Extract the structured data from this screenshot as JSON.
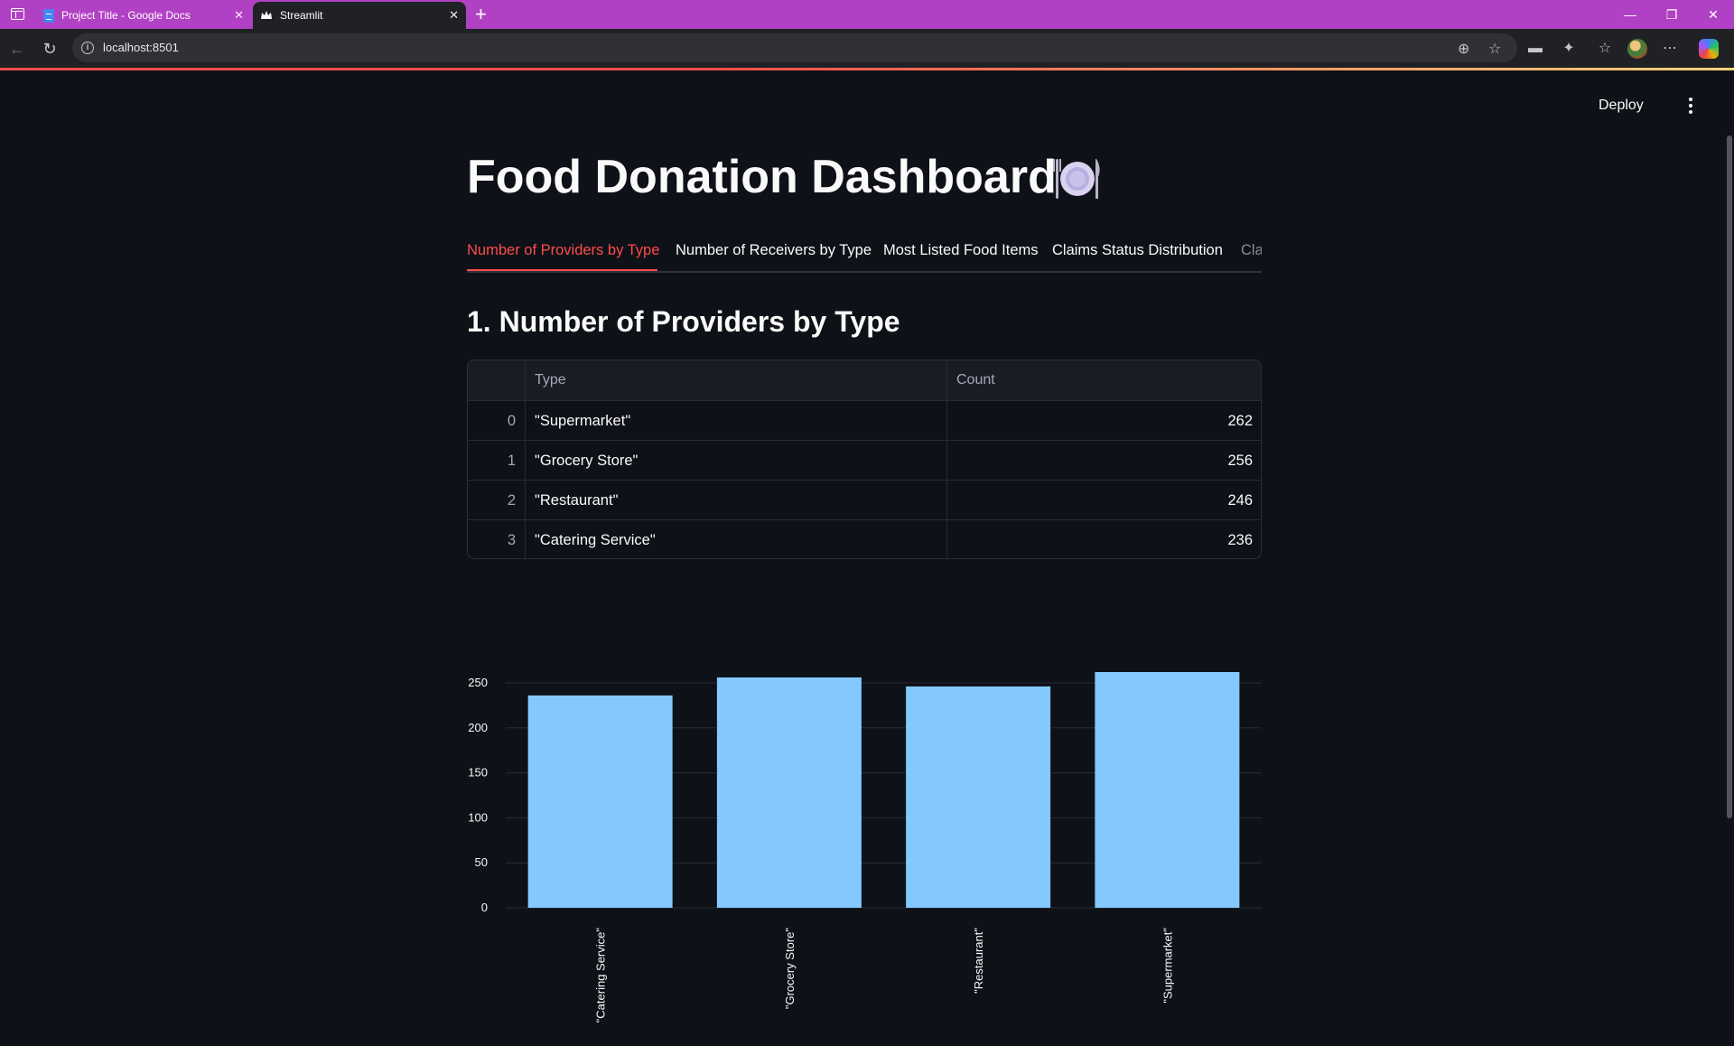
{
  "browser": {
    "tabs": [
      {
        "title": "Project Title - Google Docs"
      },
      {
        "title": "Streamlit"
      }
    ],
    "url": "localhost:8501"
  },
  "app": {
    "deploy_label": "Deploy",
    "title": "Food Donation Dashboard",
    "title_icon": "plate-with-cutlery-icon",
    "tabs": [
      {
        "label": "Number of Providers by Type"
      },
      {
        "label": "Number of Receivers by Type"
      },
      {
        "label": "Most Listed Food Items"
      },
      {
        "label": "Claims Status Distribution"
      },
      {
        "label": "Cla"
      }
    ],
    "section_title": "1. Number of Providers by Type",
    "table": {
      "columns": [
        "Type",
        "Count"
      ],
      "rows": [
        {
          "index": "0",
          "type": "\"Supermarket\"",
          "count": "262"
        },
        {
          "index": "1",
          "type": "\"Grocery Store\"",
          "count": "256"
        },
        {
          "index": "2",
          "type": "\"Restaurant\"",
          "count": "246"
        },
        {
          "index": "3",
          "type": "\"Catering Service\"",
          "count": "236"
        }
      ]
    }
  },
  "chart_data": {
    "type": "bar",
    "categories": [
      "\"Catering Service\"",
      "\"Grocery Store\"",
      "\"Restaurant\"",
      "\"Supermarket\""
    ],
    "values": [
      236,
      256,
      246,
      262
    ],
    "yticks": [
      "250",
      "200",
      "150",
      "100",
      "50",
      "0"
    ],
    "ylim": [
      0,
      262
    ],
    "bar_color": "#83c9ff",
    "grid": true
  },
  "colors": {
    "accent": "#ff4b4b",
    "background": "#0e1117",
    "titlebar": "#b141c4"
  }
}
